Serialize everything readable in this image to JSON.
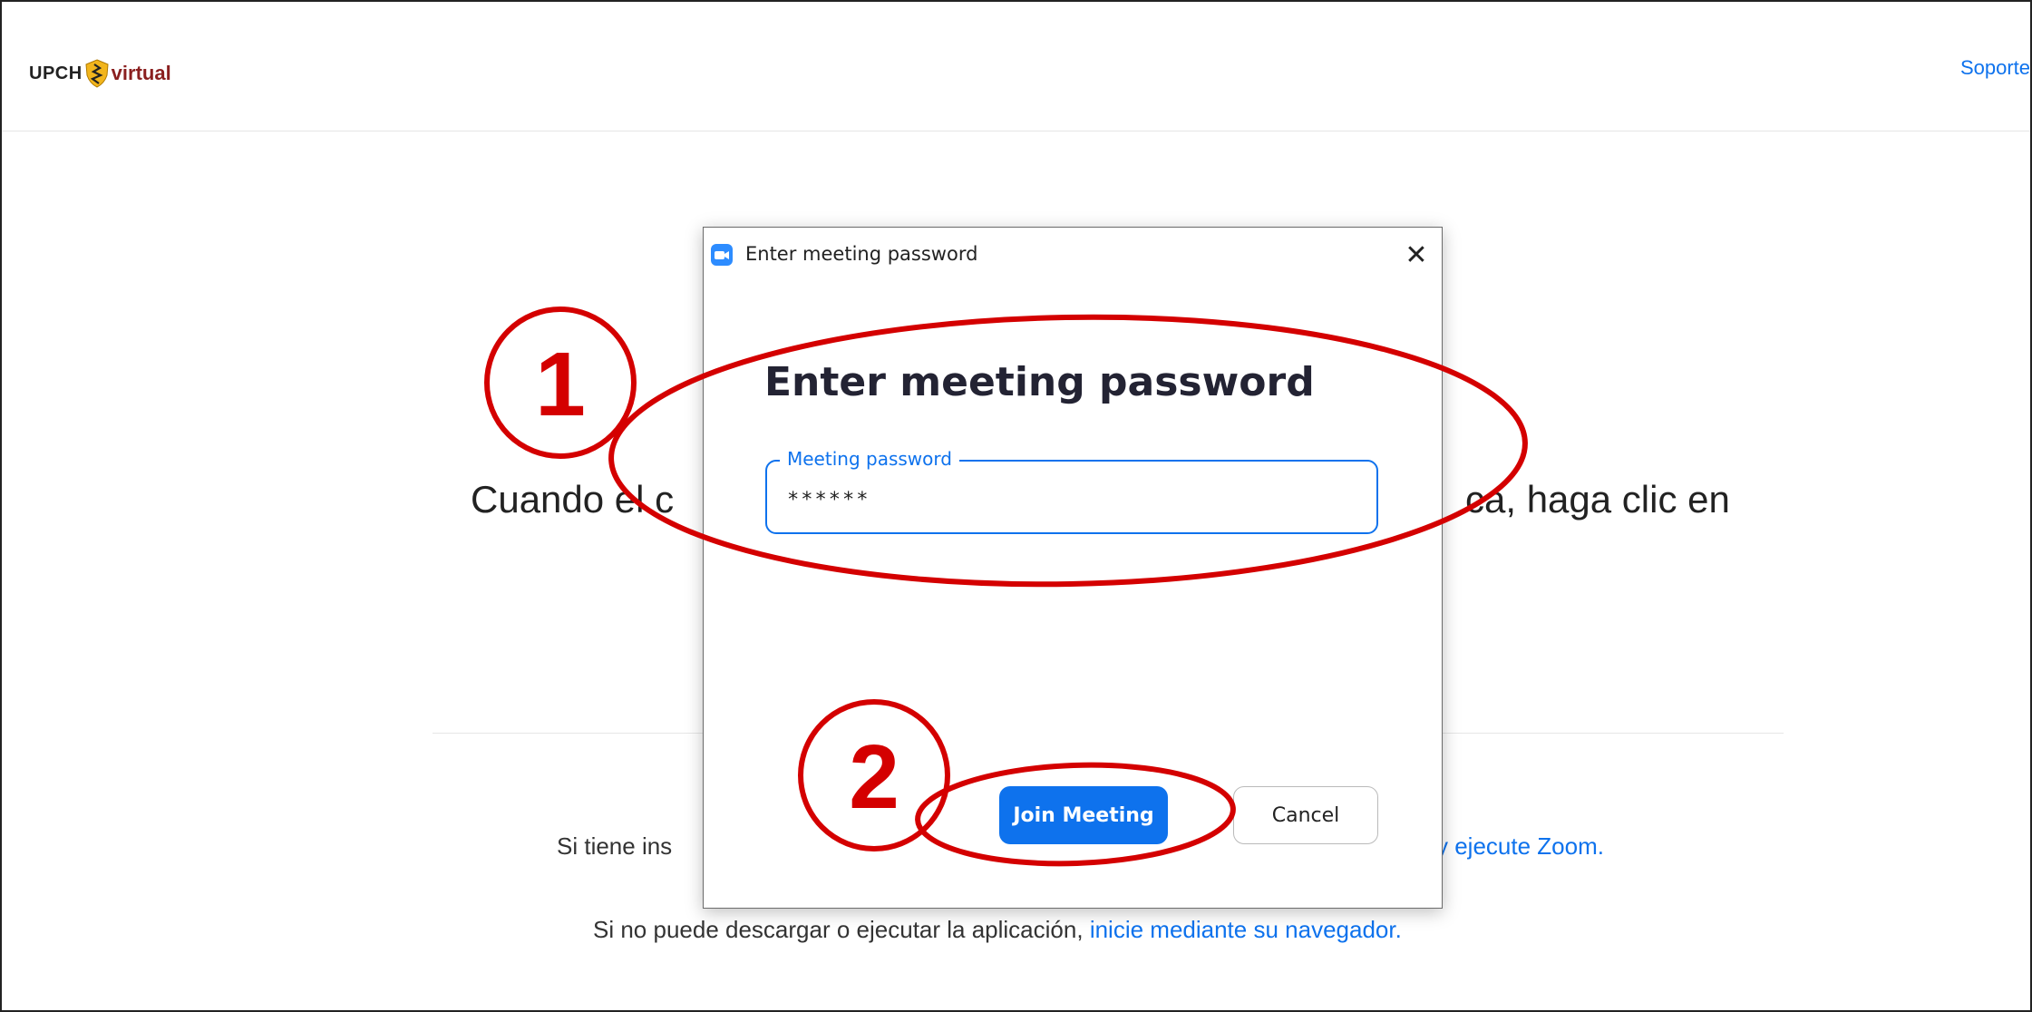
{
  "header": {
    "logo": {
      "upch": "UPCH",
      "virtual": "virtual"
    },
    "support_link": "Soporte"
  },
  "background": {
    "line1_left": "Cuando el c",
    "line1_right": "ca, haga clic en",
    "line2_left": "Si tiene ins",
    "line2_right": "y ejecute Zoom.",
    "line3_text": "Si no puede descargar o ejecutar la aplicación,",
    "line3_link": "inicie mediante su navegador."
  },
  "dialog": {
    "window_title": "Enter meeting password",
    "close_glyph": "✕",
    "heading": "Enter meeting password",
    "password_label": "Meeting password",
    "password_value": "******",
    "join_label": "Join Meeting",
    "cancel_label": "Cancel"
  },
  "annotations": {
    "step1": "1",
    "step2": "2",
    "color": "#d40000"
  },
  "colors": {
    "accent": "#0e72ed",
    "annotation": "#d40000"
  }
}
